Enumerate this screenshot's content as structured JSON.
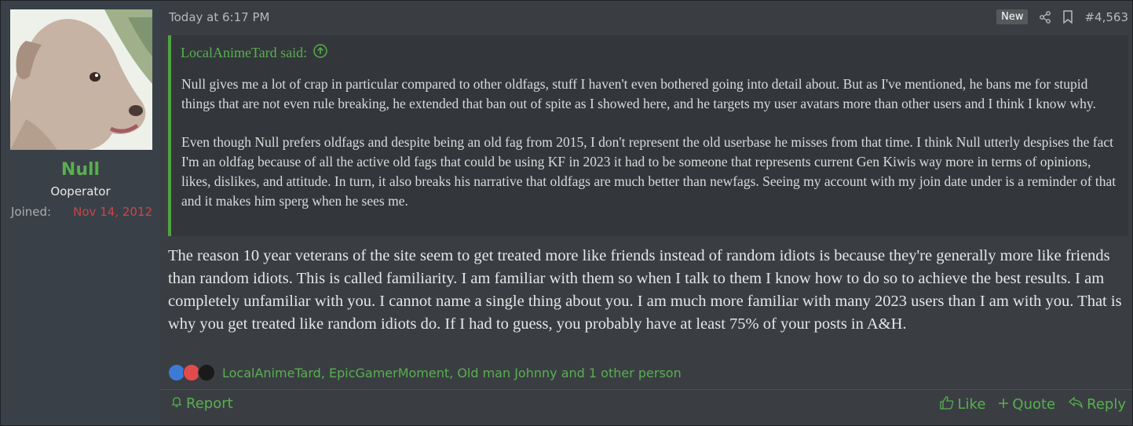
{
  "user": {
    "name": "Null",
    "title": "Ooperator",
    "joined_label": "Joined:",
    "joined_date": "Nov 14, 2012"
  },
  "post": {
    "timestamp": "Today at 6:17 PM",
    "badge": "New",
    "number": "#4,563",
    "quote": {
      "author": "LocalAnimeTard said:",
      "paragraphs": [
        "Null gives me a lot of crap in particular compared to other oldfags, stuff I haven't even bothered going into detail about. But as I've mentioned, he bans me for stupid things that are not even rule breaking, he extended that ban out of spite as I showed here, and he targets my user avatars more than other users and I think I know why.",
        "Even though Null prefers oldfags and despite being an old fag from 2015, I don't represent the old userbase he misses from that time. I think Null utterly despises the fact I'm an oldfag because of all the active old fags that could be using KF in 2023 it had to be someone that represents current Gen Kiwis way more in terms of opinions, likes, dislikes, and attitude. In turn, it also breaks his narrative that oldfags are much better than newfags. Seeing my account with my join date under is a reminder of that and it makes him sperg when he sees me."
      ]
    },
    "message": "The reason 10 year veterans of the site seem to get treated more like friends instead of random idiots is because they're generally more like friends than random idiots. This is called familiarity. I am familiar with them so when I talk to them I know how to do so to achieve the best results. I am completely unfamiliar with you. I cannot name a single thing about you. I am much more familiar with many 2023 users than I am with you. That is why you get treated like random idiots do. If I had to guess, you probably have at least 75% of your posts in A&H.",
    "reactions": {
      "icons": [
        "thumbs-up-icon",
        "alarm-clock-icon",
        "top-hat-icon"
      ],
      "names": "LocalAnimeTard, EpicGamerMoment, Old man Johnny and 1 other person"
    },
    "actions": {
      "report": "Report",
      "like": "Like",
      "quote": "Quote",
      "reply": "Reply"
    }
  },
  "colors": {
    "accent": "#58b04e",
    "joined_date": "#c9464b",
    "background": "#3a3e43"
  }
}
